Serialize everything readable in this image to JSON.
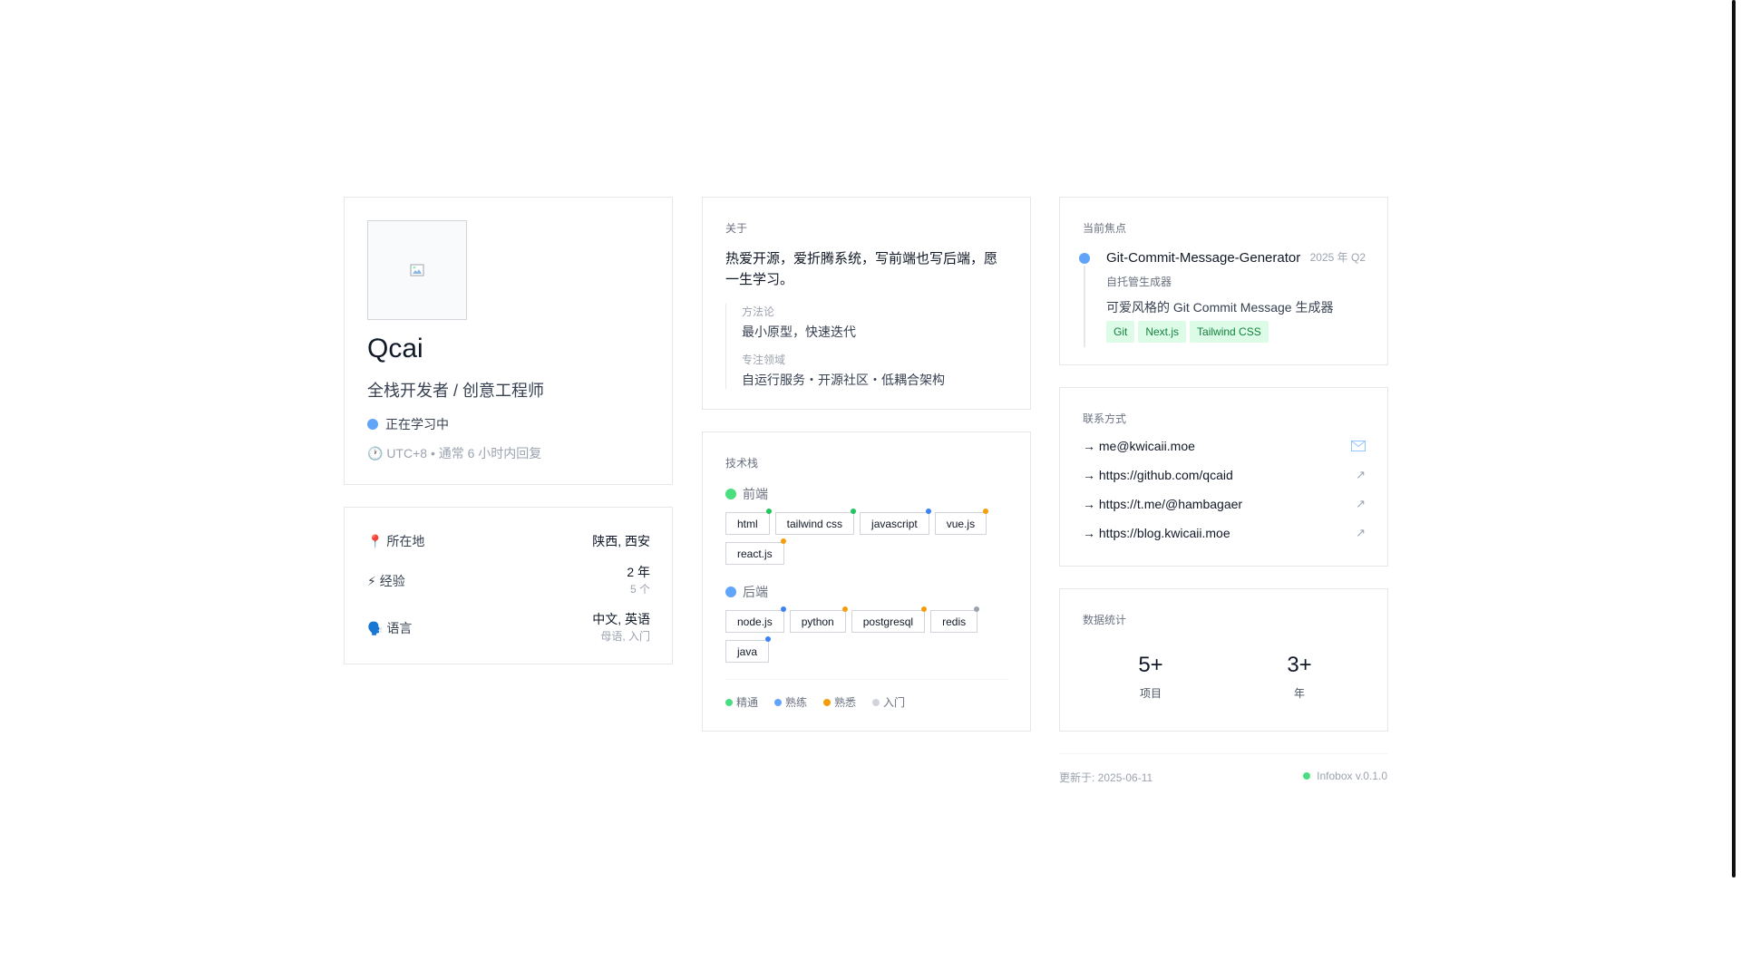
{
  "profile": {
    "name": "Qcai",
    "role": "全栈开发者 / 创意工程师",
    "status": "正在学习中",
    "status_color": "#60a5fa",
    "timezone": "🕐 UTC+8 • 通常 6 小时内回复"
  },
  "info": {
    "location": {
      "label": "📍 所在地",
      "value": "陕西, 西安"
    },
    "experience": {
      "label": "⚡ 经验",
      "value": "2 年",
      "sub": "5 个"
    },
    "language": {
      "label": "🗣️ 语言",
      "value": "中文, 英语",
      "sub": "母语, 入门"
    }
  },
  "about": {
    "title": "关于",
    "text": "热爱开源，爱折腾系统，写前端也写后端，愿一生学习。",
    "method_label": "方法论",
    "method": "最小原型，快速迭代",
    "focus_label": "专注领域",
    "focus": "自运行服务・开源社区・低耦合架构"
  },
  "tech": {
    "title": "技术栈",
    "frontend": {
      "label": "前端",
      "color": "#4ade80",
      "tags": [
        {
          "name": "html",
          "level": "#22c55e"
        },
        {
          "name": "tailwind css",
          "level": "#22c55e"
        },
        {
          "name": "javascript",
          "level": "#3b82f6"
        },
        {
          "name": "vue.js",
          "level": "#f59e0b"
        },
        {
          "name": "react.js",
          "level": "#f59e0b"
        }
      ]
    },
    "backend": {
      "label": "后端",
      "color": "#60a5fa",
      "tags": [
        {
          "name": "node.js",
          "level": "#3b82f6"
        },
        {
          "name": "python",
          "level": "#f59e0b"
        },
        {
          "name": "postgresql",
          "level": "#f59e0b"
        },
        {
          "name": "redis",
          "level": "#9ca3af"
        },
        {
          "name": "java",
          "level": "#3b82f6"
        }
      ]
    },
    "legend": [
      {
        "label": "精通",
        "color": "#4ade80"
      },
      {
        "label": "熟练",
        "color": "#60a5fa"
      },
      {
        "label": "熟悉",
        "color": "#f59e0b"
      },
      {
        "label": "入门",
        "color": "#d1d5db"
      }
    ]
  },
  "focus": {
    "title": "当前焦点",
    "project": "Git-Commit-Message-Generator",
    "date": "2025 年 Q2",
    "sub": "自托管生成器",
    "desc": "可爱风格的 Git Commit Message 生成器",
    "tags": [
      "Git",
      "Next.js",
      "Tailwind CSS"
    ]
  },
  "contact": {
    "title": "联系方式",
    "items": [
      {
        "text": "→ me@kwicaii.moe",
        "icon": "mail-icon"
      },
      {
        "text": "→ https://github.com/qcaid",
        "icon": "external-link-icon"
      },
      {
        "text": "→ https://t.me/@hambagaer",
        "icon": "external-link-icon"
      },
      {
        "text": "→ https://blog.kwicaii.moe",
        "icon": "external-link-icon"
      }
    ]
  },
  "stats": {
    "title": "数据统计",
    "projects": {
      "num": "5+",
      "label": "项目"
    },
    "years": {
      "num": "3+",
      "label": "年"
    }
  },
  "footer": {
    "updated": "更新于: 2025-06-11",
    "version": "Infobox v.0.1.0",
    "status_color": "#4ade80"
  }
}
